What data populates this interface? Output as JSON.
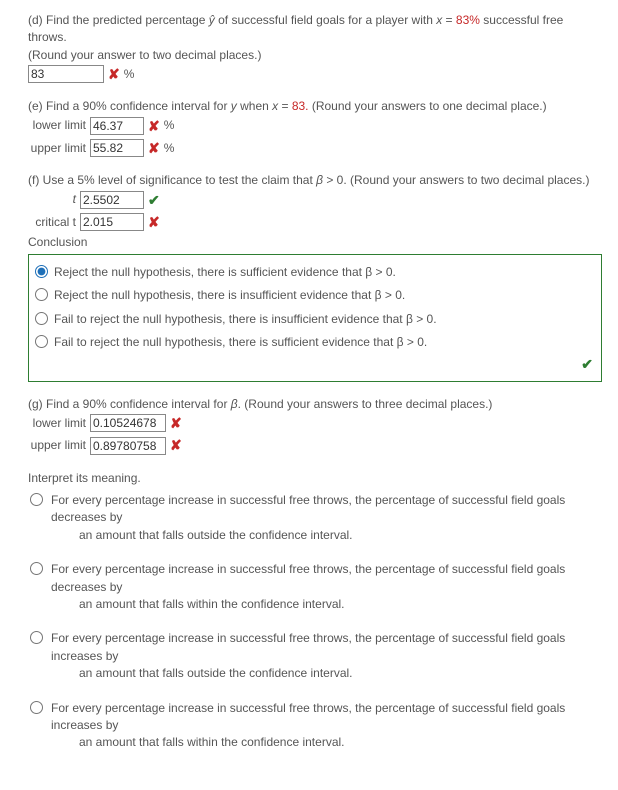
{
  "d": {
    "prompt_pre": "(d) Find the predicted percentage ",
    "yhat": "ŷ",
    "prompt_mid": " of successful field goals for a player with ",
    "xvar": "x",
    "eq": " = ",
    "xval": "83%",
    "prompt_post": " successful free throws.",
    "round": "(Round your answer to two decimal places.)",
    "input": "83",
    "pct": "%"
  },
  "e": {
    "prompt_pre": "(e) Find a 90% confidence interval for ",
    "yvar": "y",
    "when": " when ",
    "xvar": "x",
    "eq": " = ",
    "xval": "83.",
    "round": " (Round your answers to one decimal place.)",
    "lower_lbl": "lower limit",
    "lower_val": "46.37",
    "upper_lbl": "upper limit",
    "upper_val": "55.82",
    "pct": "%"
  },
  "f": {
    "prompt_pre": "(f) Use a 5% level of significance to test the claim that ",
    "beta": "β",
    "gt0": " > 0. (Round your answers to two decimal places.)",
    "t_lbl": "t",
    "t_val": "2.5502",
    "crit_lbl": "critical t",
    "crit_val": "2.015",
    "conclusion_lbl": "Conclusion",
    "opts": [
      "Reject the null hypothesis, there is sufficient evidence that β > 0.",
      "Reject the null hypothesis, there is insufficient evidence that β > 0.",
      "Fail to reject the null hypothesis, there is insufficient evidence that β > 0.",
      "Fail to reject the null hypothesis, there is sufficient evidence that β > 0."
    ]
  },
  "g": {
    "prompt_pre": "(g) Find a 90% confidence interval for ",
    "beta": "β",
    "round": ". (Round your answers to three decimal places.)",
    "lower_lbl": "lower limit",
    "lower_val": "0.10524678",
    "upper_lbl": "upper limit",
    "upper_val": "0.89780758"
  },
  "interp": {
    "heading": "Interpret its meaning.",
    "opts": [
      {
        "l1": "For every percentage increase in successful free throws, the percentage of successful field goals decreases by",
        "l2": "an amount that falls outside the confidence interval."
      },
      {
        "l1": "For every percentage increase in successful free throws, the percentage of successful field goals decreases by",
        "l2": "an amount that falls within the confidence interval."
      },
      {
        "l1": "For every percentage increase in successful free throws, the percentage of successful field goals increases by",
        "l2": "an amount that falls outside the confidence interval."
      },
      {
        "l1": "For every percentage increase in successful free throws, the percentage of successful field goals increases by",
        "l2": "an amount that falls within the confidence interval."
      }
    ]
  }
}
